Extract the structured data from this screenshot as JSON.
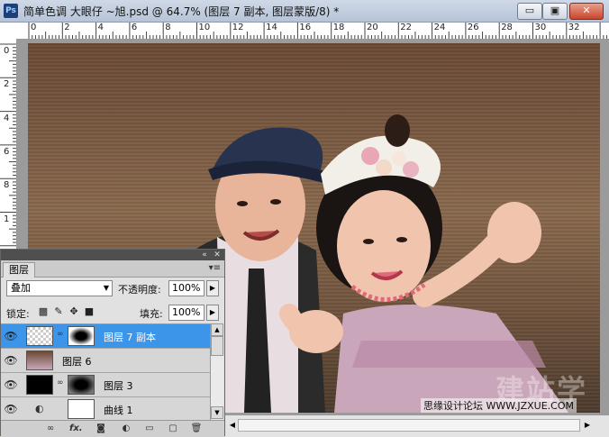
{
  "window": {
    "title": "简单色调 大眼仔 ~旭.psd @ 64.7% (图层 7 副本, 图层蒙版/8) *",
    "app_icon": "Ps",
    "buttons": [
      "▭",
      "▣",
      "✕"
    ]
  },
  "ruler_top_ticks": [
    "0",
    "2",
    "4",
    "6",
    "8",
    "10",
    "12",
    "14",
    "16",
    "18",
    "20",
    "22",
    "24",
    "26",
    "28",
    "30",
    "32"
  ],
  "ruler_left_ticks": [
    "0",
    "2",
    "4",
    "6",
    "8",
    "1"
  ],
  "watermark": {
    "big": "建站学",
    "small": "思缘设计论坛 WWW.JZXUE.COM"
  },
  "layers_panel": {
    "tab": "图层",
    "blend_mode": "叠加",
    "opacity_label": "不透明度:",
    "opacity_value": "100%",
    "lock_label": "锁定:",
    "fill_label": "填充:",
    "fill_value": "100%",
    "layers": [
      {
        "name": "图层 7 副本",
        "selected": true
      },
      {
        "name": "图层 6",
        "selected": false
      },
      {
        "name": "图层 3",
        "selected": false
      },
      {
        "name": "曲线 1",
        "selected": false
      }
    ],
    "footer_icons": [
      "link-icon",
      "fx-icon",
      "mask-icon",
      "adjustment-icon",
      "group-icon",
      "new-layer-icon",
      "trash-icon"
    ],
    "footer_fx": "fx."
  },
  "colors": {
    "selected_layer": "#3d95ea",
    "panel_bg": "#e1e1e1"
  }
}
